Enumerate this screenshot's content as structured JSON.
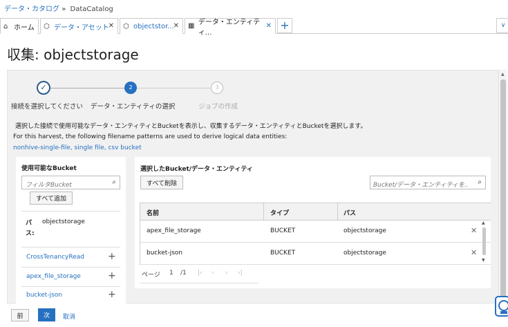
{
  "breadcrumb": {
    "root": "データ・カタログ",
    "separator": "»",
    "current": "DataCatalog"
  },
  "tabs": [
    {
      "label": "ホーム",
      "icon": "home-icon"
    },
    {
      "label": "データ・アセット",
      "icon": "cube-icon"
    },
    {
      "label": "objectstor...",
      "icon": "cube-icon"
    },
    {
      "label": "データ・エンティティ...",
      "icon": "table-icon"
    }
  ],
  "page_title": "収集: objectstorage",
  "steps": [
    {
      "number": "",
      "label": "接続を選択してください",
      "state": "completed"
    },
    {
      "number": "2",
      "label": "データ・エンティティの選択",
      "state": "current"
    },
    {
      "number": "3",
      "label": "ジョブの作成",
      "state": "disabled"
    }
  ],
  "description": "選択した接続で使用可能なデータ・エンティティとBucketを表示し、収集するデータ・エンティティとBucketを選択します。",
  "filename_note": "For this harvest, the following filename patterns are used to derive logical data entities:",
  "filename_link": "nonhive-single-file, single file, csv bucket",
  "left_panel": {
    "title": "使用可能なBucket",
    "filter_placeholder": "フィルタBucket",
    "add_all": "すべて追加",
    "path_label": "パス:",
    "path_value": "objectstorage",
    "buckets": [
      "CrossTenancyRead",
      "apex_file_storage",
      "bucket-json"
    ]
  },
  "right_panel": {
    "title": "選択したBucket/データ・エンティティ",
    "remove_all": "すべて削除",
    "search_placeholder": "Bucket/データ・エンティティを...",
    "columns": [
      "名前",
      "タイプ",
      "パス"
    ],
    "rows": [
      {
        "name": "apex_file_storage",
        "type": "BUCKET",
        "path": "objectstorage"
      },
      {
        "name": "bucket-json",
        "type": "BUCKET",
        "path": "objectstorage"
      }
    ],
    "pager": {
      "label": "ページ",
      "current": "1",
      "total": "/1"
    }
  },
  "footer": {
    "prev": "前",
    "next": "次",
    "cancel": "取消"
  }
}
